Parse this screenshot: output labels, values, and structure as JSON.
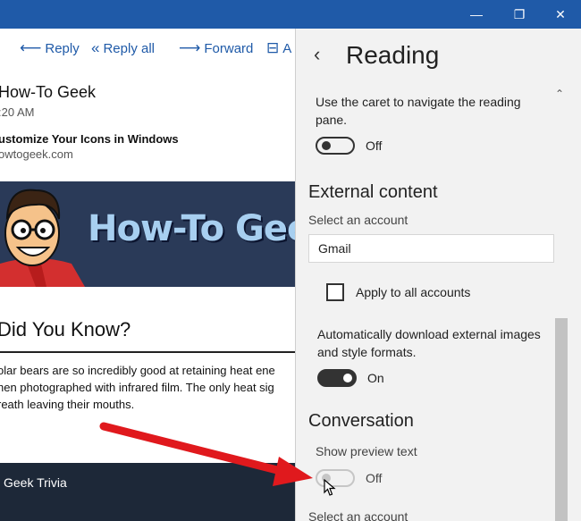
{
  "window": {
    "minimize": "—",
    "maximize": "❐",
    "close": "✕"
  },
  "toolbar": {
    "reply": "Reply",
    "reply_all": "Reply all",
    "forward": "Forward",
    "archive": "A"
  },
  "message": {
    "sender": "How-To Geek",
    "time": ":20 AM",
    "subject": "ustomize Your Icons in Windows",
    "domain": "owtogeek.com",
    "banner_title": "How-To Geek N",
    "did_you_know": "Did You Know?",
    "body_lines": [
      "olar bears are so incredibly good at retaining heat ene",
      "hen photographed with infrared film. The only heat sig",
      "reath leaving their mouths."
    ],
    "footer": "Geek Trivia"
  },
  "settings": {
    "back": "‹",
    "title": "Reading",
    "caret_text": "Use the caret to navigate the reading pane.",
    "caret_toggle": "Off",
    "external_heading": "External content",
    "select_account": "Select an account",
    "account_value": "Gmail",
    "apply_all": "Apply to all accounts",
    "auto_download": "Automatically download external images and style formats.",
    "auto_toggle": "On",
    "conversation_heading": "Conversation",
    "show_preview": "Show preview text",
    "preview_toggle": "Off",
    "select_account_2": "Select an account"
  },
  "colors": {
    "titlebar": "#1f5aa8",
    "accent": "#1f5aa8",
    "arrow": "#e0191d"
  }
}
